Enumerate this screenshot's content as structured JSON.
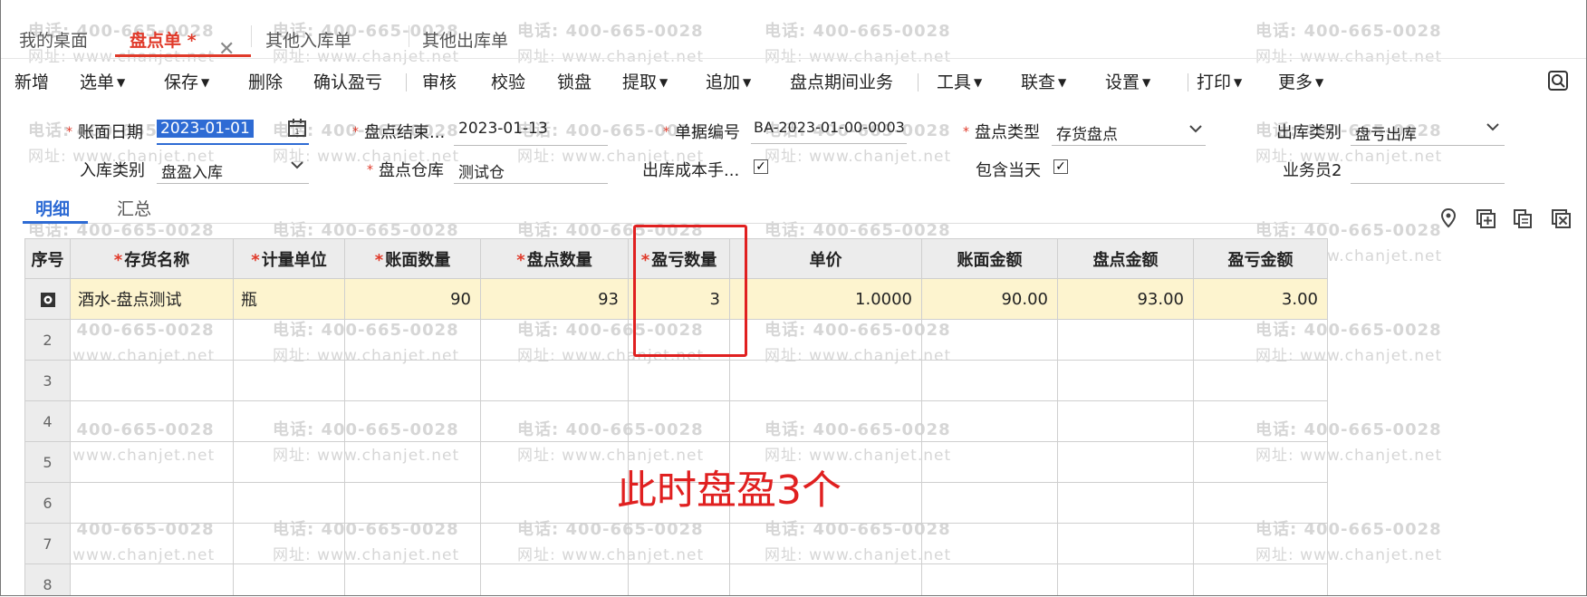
{
  "tabs": [
    {
      "label": "我的桌面",
      "active": false
    },
    {
      "label": "盘点单 *",
      "active": true
    },
    {
      "label": "其他入库单",
      "active": false
    },
    {
      "label": "其他出库单",
      "active": false
    }
  ],
  "toolbar": {
    "items": [
      "新增",
      "选单",
      "保存",
      "删除",
      "确认盈亏",
      "审核",
      "校验",
      "锁盘",
      "提取",
      "追加",
      "盘点期间业务",
      "工具",
      "联查",
      "设置",
      "打印",
      "更多"
    ]
  },
  "form": {
    "book_date_label": "账面日期",
    "book_date_value": "2023-01-01",
    "end_label": "盘点结束...",
    "end_value": "2023-01-13",
    "doc_no_label": "单据编号",
    "doc_no_value": "BA-2023-01-00-0003",
    "type_label": "盘点类型",
    "type_value": "存货盘点",
    "out_cat_label": "出库类别",
    "out_cat_value": "盘亏出库",
    "in_cat_label": "入库类别",
    "in_cat_value": "盘盈入库",
    "warehouse_label": "盘点仓库",
    "warehouse_value": "测试仓",
    "out_cost_label": "出库成本手...",
    "include_today_label": "包含当天",
    "salesman_label": "业务员2"
  },
  "subtabs": {
    "detail": "明细",
    "summary": "汇总"
  },
  "grid": {
    "headers": [
      "序号",
      "存货名称",
      "计量单位",
      "账面数量",
      "盘点数量",
      "盈亏数量",
      "单价",
      "账面金额",
      "盘点金额",
      "盈亏金额"
    ],
    "row1": {
      "name": "酒水-盘点测试",
      "unit": "瓶",
      "book_qty": "90",
      "count_qty": "93",
      "diff_qty": "3",
      "price": "1.0000",
      "book_amt": "90.00",
      "count_amt": "93.00",
      "diff_amt": "3.00"
    },
    "row_numbers": [
      "2",
      "3",
      "4",
      "5",
      "6",
      "7",
      "8"
    ]
  },
  "annotation": "此时盘盈3个",
  "watermark": {
    "phone": "电话: 400-665-0028",
    "site": "网址: www.chanjet.net"
  },
  "colors": {
    "accent_red": "#e03a2a",
    "accent_blue": "#2e6bd4",
    "annotation_red": "#e02020",
    "selected_row": "#fdf4cf"
  }
}
